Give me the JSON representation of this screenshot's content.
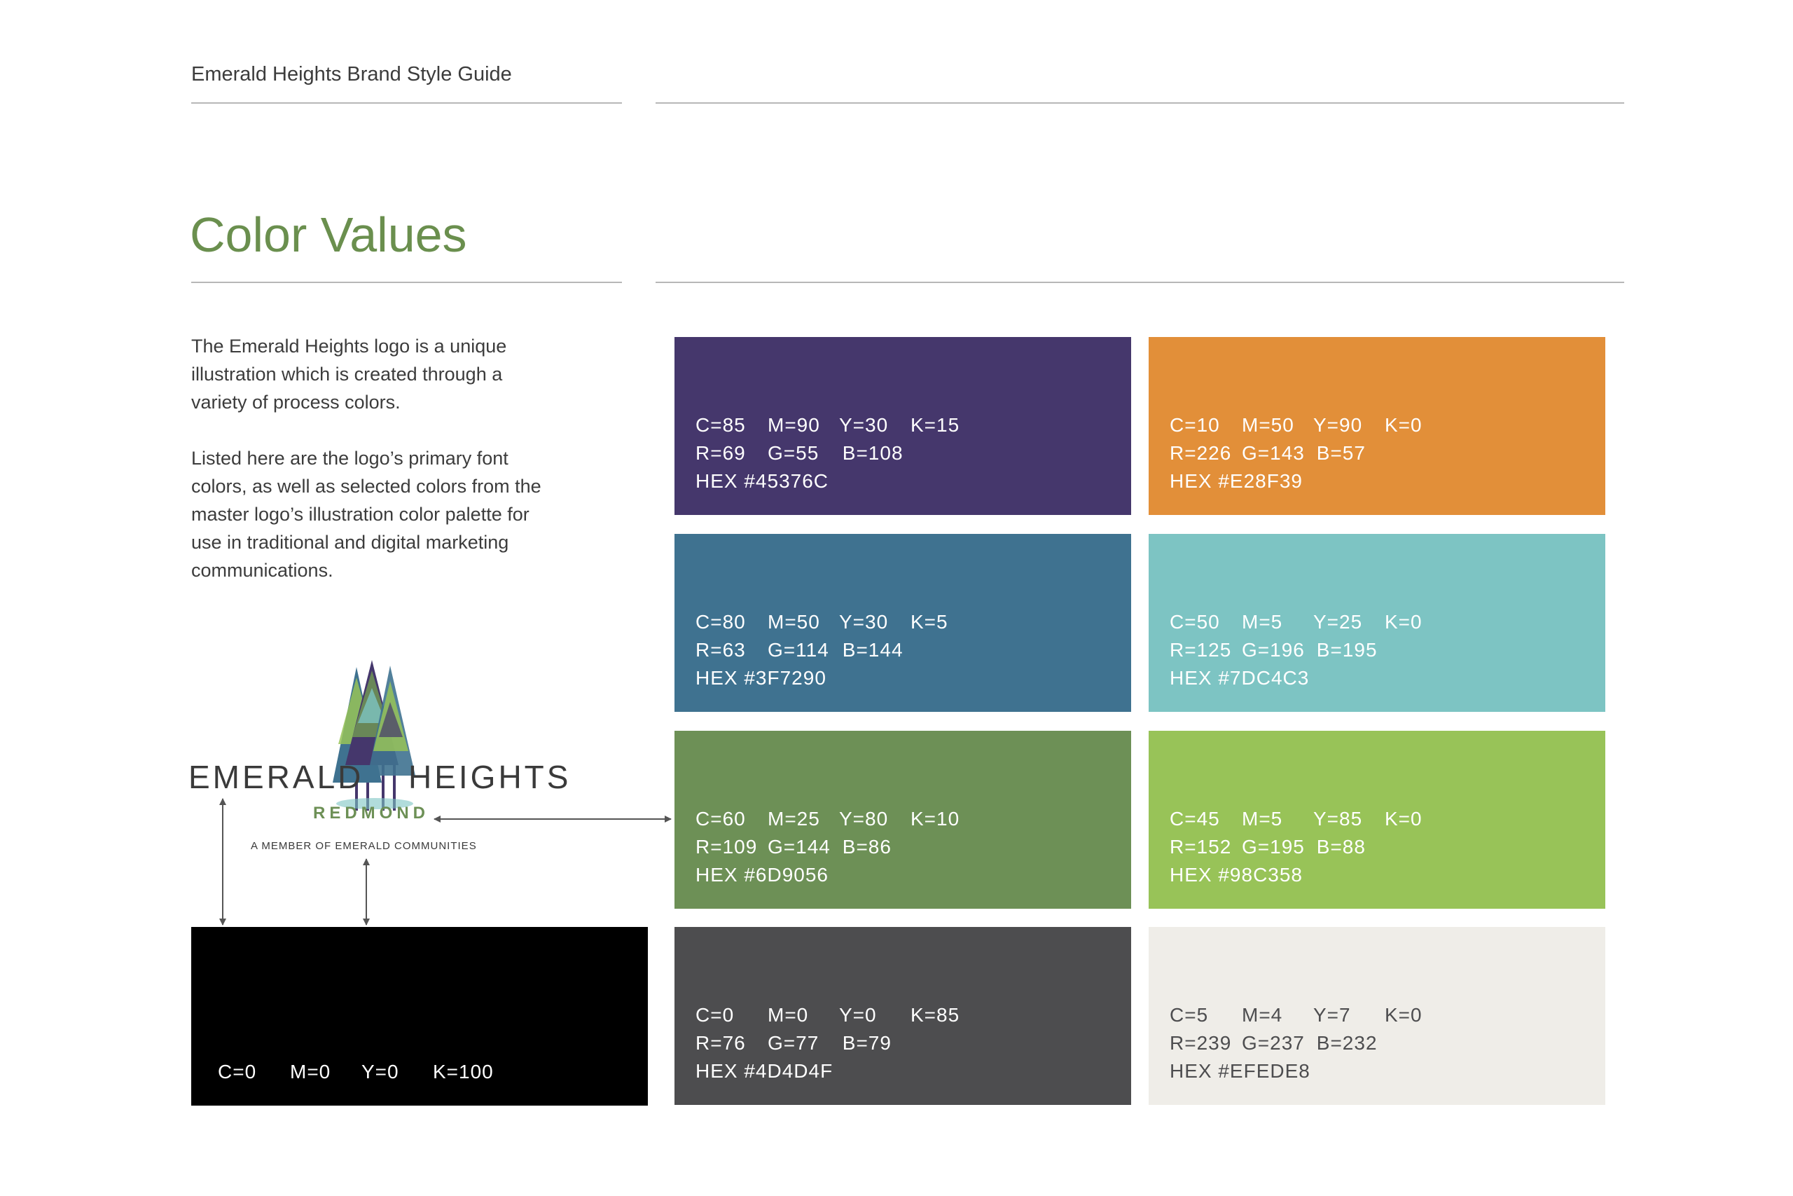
{
  "header": {
    "title": "Emerald Heights Brand Style Guide"
  },
  "page": {
    "title": "Color Values",
    "intro_paragraphs": [
      "The Emerald Heights logo is a unique illustration which is created through a variety of process colors.",
      "Listed here are the logo’s primary font colors, as well as selected colors from the master logo’s illustration color palette for use in traditional and digital marketing communications."
    ]
  },
  "logo": {
    "word_left": "EMERALD",
    "word_right": "HEIGHTS",
    "location": "REDMOND",
    "tagline": "A MEMBER OF EMERALD COMMUNITIES",
    "icon": "pine-trees-icon"
  },
  "black_swatch": {
    "color": "#000000",
    "c": "C=0",
    "m": "M=0",
    "y": "Y=0",
    "k": "K=100"
  },
  "swatches": [
    {
      "color": "#45376C",
      "text_color": "#ffffff",
      "c": "C=85",
      "m": "M=90",
      "y": "Y=30",
      "k": "K=15",
      "r": "R=69",
      "g": "G=55",
      "b": "B=108",
      "hex": "HEX #45376C"
    },
    {
      "color": "#E28F39",
      "text_color": "#ffffff",
      "c": "C=10",
      "m": "M=50",
      "y": "Y=90",
      "k": "K=0",
      "r": "R=226",
      "g": "G=143",
      "b": "B=57",
      "hex": "HEX #E28F39"
    },
    {
      "color": "#3F7290",
      "text_color": "#ffffff",
      "c": "C=80",
      "m": "M=50",
      "y": "Y=30",
      "k": "K=5",
      "r": "R=63",
      "g": "G=114",
      "b": "B=144",
      "hex": "HEX #3F7290"
    },
    {
      "color": "#7DC4C3",
      "text_color": "#ffffff",
      "c": "C=50",
      "m": "M=5",
      "y": "Y=25",
      "k": "K=0",
      "r": "R=125",
      "g": "G=196",
      "b": "B=195",
      "hex": "HEX #7DC4C3"
    },
    {
      "color": "#6D9056",
      "text_color": "#ffffff",
      "c": "C=60",
      "m": "M=25",
      "y": "Y=80",
      "k": "K=10",
      "r": "R=109",
      "g": "G=144",
      "b": "B=86",
      "hex": "HEX #6D9056"
    },
    {
      "color": "#98C358",
      "text_color": "#ffffff",
      "c": "C=45",
      "m": "M=5",
      "y": "Y=85",
      "k": "K=0",
      "r": "R=152",
      "g": "G=195",
      "b": "B=88",
      "hex": "HEX #98C358"
    },
    {
      "color": "#4D4D4F",
      "text_color": "#ffffff",
      "c": "C=0",
      "m": "M=0",
      "y": "Y=0",
      "k": "K=85",
      "r": "R=76",
      "g": "G=77",
      "b": "B=79",
      "hex": "HEX #4D4D4F"
    },
    {
      "color": "#EFEDE8",
      "text_color": "#4d4d4f",
      "c": "C=5",
      "m": "M=4",
      "y": "Y=7",
      "k": "K=0",
      "r": "R=239",
      "g": "G=237",
      "b": "B=232",
      "hex": "HEX #EFEDE8"
    }
  ]
}
